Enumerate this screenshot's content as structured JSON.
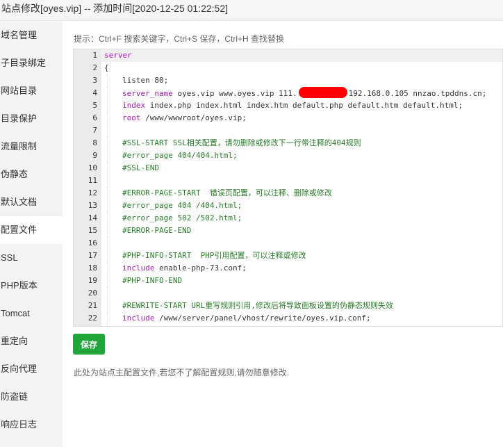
{
  "title": "站点修改[oyes.vip] -- 添加时间[2020-12-25 01:22:52]",
  "sidebar": {
    "items": [
      {
        "label": "域名管理"
      },
      {
        "label": "子目录绑定"
      },
      {
        "label": "网站目录"
      },
      {
        "label": "目录保护"
      },
      {
        "label": "流量限制"
      },
      {
        "label": "伪静态"
      },
      {
        "label": "默认文档"
      },
      {
        "label": "配置文件",
        "active": true
      },
      {
        "label": "SSL"
      },
      {
        "label": "PHP版本"
      },
      {
        "label": "Tomcat"
      },
      {
        "label": "重定向"
      },
      {
        "label": "反向代理"
      },
      {
        "label": "防盗链"
      },
      {
        "label": "响应日志"
      }
    ]
  },
  "hint": "提示：Ctrl+F 搜索关键字，Ctrl+S 保存，Ctrl+H 查找替换",
  "editor": {
    "lines": [
      {
        "n": "1",
        "indent": 0,
        "parts": [
          {
            "t": "server",
            "c": "kw"
          }
        ]
      },
      {
        "n": "2",
        "indent": 0,
        "parts": [
          {
            "t": "{",
            "c": ""
          }
        ]
      },
      {
        "n": "3",
        "indent": 1,
        "parts": [
          {
            "t": "listen 80;",
            "c": ""
          }
        ]
      },
      {
        "n": "4",
        "indent": 1,
        "parts": [
          {
            "t": "server_name",
            "c": "dir"
          },
          {
            "t": " oyes.vip www.oyes.vip 111.",
            "c": ""
          },
          {
            "t": "",
            "c": "redact"
          },
          {
            "t": "192.168.0.105 nnzao.tpddns.cn;",
            "c": ""
          }
        ]
      },
      {
        "n": "5",
        "indent": 1,
        "parts": [
          {
            "t": "index",
            "c": "dir"
          },
          {
            "t": " index.php index.html index.htm default.php default.htm default.html;",
            "c": ""
          }
        ]
      },
      {
        "n": "6",
        "indent": 1,
        "parts": [
          {
            "t": "root",
            "c": "dir"
          },
          {
            "t": " /www/wwwroot/oyes.vip;",
            "c": ""
          }
        ]
      },
      {
        "n": "7",
        "indent": 1,
        "parts": []
      },
      {
        "n": "8",
        "indent": 1,
        "parts": [
          {
            "t": "#SSL-START SSL相关配置，请勿删除或修改下一行带注释的404规则",
            "c": "cm"
          }
        ]
      },
      {
        "n": "9",
        "indent": 1,
        "parts": [
          {
            "t": "#error_page 404/404.html;",
            "c": "cm"
          }
        ]
      },
      {
        "n": "10",
        "indent": 1,
        "parts": [
          {
            "t": "#SSL-END",
            "c": "cm"
          }
        ]
      },
      {
        "n": "11",
        "indent": 1,
        "parts": []
      },
      {
        "n": "12",
        "indent": 1,
        "parts": [
          {
            "t": "#ERROR-PAGE-START  错误页配置，可以注释、删除或修改",
            "c": "cm"
          }
        ]
      },
      {
        "n": "13",
        "indent": 1,
        "parts": [
          {
            "t": "#error_page 404 /404.html;",
            "c": "cm"
          }
        ]
      },
      {
        "n": "14",
        "indent": 1,
        "parts": [
          {
            "t": "#error_page 502 /502.html;",
            "c": "cm"
          }
        ]
      },
      {
        "n": "15",
        "indent": 1,
        "parts": [
          {
            "t": "#ERROR-PAGE-END",
            "c": "cm"
          }
        ]
      },
      {
        "n": "16",
        "indent": 1,
        "parts": []
      },
      {
        "n": "17",
        "indent": 1,
        "parts": [
          {
            "t": "#PHP-INFO-START  PHP引用配置，可以注释或修改",
            "c": "cm"
          }
        ]
      },
      {
        "n": "18",
        "indent": 1,
        "parts": [
          {
            "t": "include",
            "c": "dir"
          },
          {
            "t": " enable-php-73.conf;",
            "c": ""
          }
        ]
      },
      {
        "n": "19",
        "indent": 1,
        "parts": [
          {
            "t": "#PHP-INFO-END",
            "c": "cm"
          }
        ]
      },
      {
        "n": "20",
        "indent": 1,
        "parts": []
      },
      {
        "n": "21",
        "indent": 1,
        "parts": [
          {
            "t": "#REWRITE-START URL重写规则引用,修改后将导致面板设置的伪静态规则失效",
            "c": "cm"
          }
        ]
      },
      {
        "n": "22",
        "indent": 1,
        "parts": [
          {
            "t": "include",
            "c": "dir"
          },
          {
            "t": " /www/server/panel/vhost/rewrite/oyes.vip.conf;",
            "c": ""
          }
        ]
      }
    ]
  },
  "save_label": "保存",
  "note": "此处为站点主配置文件,若您不了解配置规则,请勿随意修改."
}
